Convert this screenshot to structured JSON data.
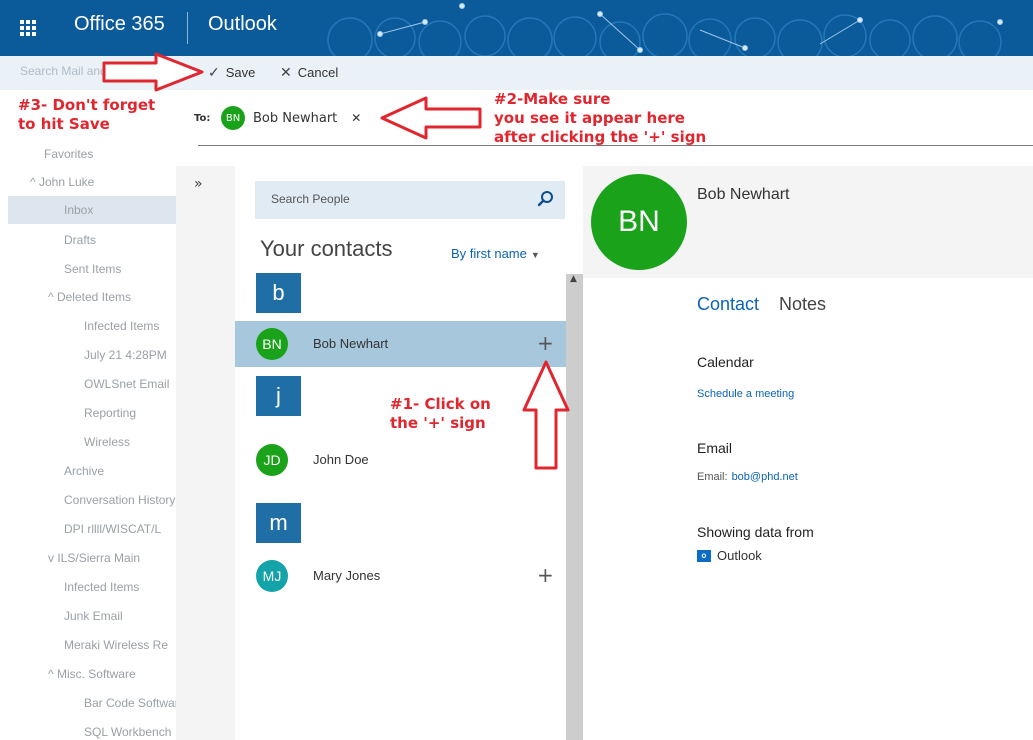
{
  "suite": {
    "suite_name": "Office 365",
    "app_name": "Outlook"
  },
  "commands": {
    "search_mail": "Search Mail and People",
    "save_label": "Save",
    "cancel_label": "Cancel"
  },
  "folders": {
    "favorites": "Favorites",
    "account": "John Luke",
    "inbox": "Inbox",
    "drafts": "Drafts",
    "sent": "Sent Items",
    "deleted": "Deleted Items",
    "infected1": "Infected Items",
    "july": "July 21 4:28PM",
    "owlsnet": "OWLSnet Email",
    "reporting": "Reporting",
    "wireless": "Wireless",
    "archive": "Archive",
    "conv_history": "Conversation History",
    "dpi": "DPI rllll/WISCAT/L",
    "ils": "ILS/Sierra Main",
    "infected2": "Infected Items",
    "junk": "Junk Email",
    "meraki": "Meraki Wireless Re",
    "misc": "Misc. Software",
    "barcode": "Bar Code Software",
    "sql": "SQL Workbench"
  },
  "to_field": {
    "label": "To:",
    "recipient_initials": "BN",
    "recipient_name": "Bob Newhart",
    "remove_glyph": "✕"
  },
  "people": {
    "search_placeholder": "Search People",
    "heading": "Your contacts",
    "sort_label": "By first name",
    "groups": [
      {
        "letter": "b",
        "contacts": [
          {
            "initials": "BN",
            "name": "Bob Newhart",
            "color": "#1aa31a"
          }
        ]
      },
      {
        "letter": "j",
        "contacts": [
          {
            "initials": "JD",
            "name": "John Doe",
            "color": "#1aa31a"
          }
        ]
      },
      {
        "letter": "m",
        "contacts": [
          {
            "initials": "MJ",
            "name": "Mary Jones",
            "color": "#14a3a8"
          }
        ]
      }
    ]
  },
  "details": {
    "initials": "BN",
    "name": "Bob Newhart",
    "tab_contact": "Contact",
    "tab_notes": "Notes",
    "calendar_title": "Calendar",
    "schedule_link": "Schedule a meeting",
    "email_title": "Email",
    "email_label": "Email:",
    "email_value": "bob@phd.net",
    "source_title": "Showing data from",
    "source_name": "Outlook",
    "source_icon_letter": "o"
  },
  "annotations": {
    "step1_line1": "#1- Click on",
    "step1_line2": "the '+' sign",
    "step2_line1": "#2-Make sure",
    "step2_line2": "you see it appear here",
    "step2_line3": "after clicking the '+' sign",
    "step3_line1": "#3- Don't forget",
    "step3_line2": "to hit Save"
  },
  "colors": {
    "suite_bar": "#0b5a9a",
    "accent": "#0b63b6",
    "selected_row": "#a7c7dc",
    "annotation": "#e0262e"
  }
}
